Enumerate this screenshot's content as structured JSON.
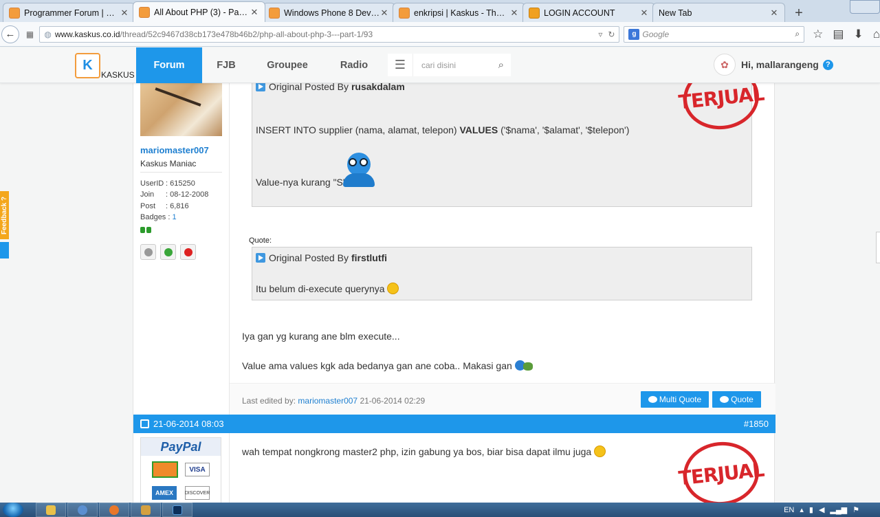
{
  "browser": {
    "tabs": [
      {
        "title": "Programmer Forum | Ka...",
        "icon": "kaskus-favicon",
        "active": false
      },
      {
        "title": "All About PHP (3) - Part...",
        "icon": "kaskus-favicon",
        "active": true
      },
      {
        "title": "Windows Phone 8 Devel...",
        "icon": "kaskus-favicon",
        "active": false
      },
      {
        "title": "enkripsi | Kaskus - The L...",
        "icon": "kaskus-favicon",
        "active": false
      },
      {
        "title": "LOGIN ACCOUNT",
        "icon": "login-favicon",
        "active": false
      },
      {
        "title": "New Tab",
        "icon": "",
        "active": false
      }
    ],
    "url_domain": "www.kaskus.co.id",
    "url_path": "/thread/52c9467d38cb173e478b46b2/php-all-about-php-3---part-1/93",
    "search_placeholder": "Google",
    "search_engine_letter": "g"
  },
  "header": {
    "logo_text": "KASKUS",
    "logo_letter": "K",
    "nav": [
      "Forum",
      "FJB",
      "Groupee",
      "Radio"
    ],
    "search_placeholder": "cari disini",
    "greeting": "Hi, mallarangeng",
    "help": "?"
  },
  "sidebar_feedback": "Feedback ?",
  "post1": {
    "user": {
      "name": "mariomaster007",
      "rank": "Kaskus Maniac",
      "stats": [
        {
          "k": "UserID",
          "v": ": 615250"
        },
        {
          "k": "Join",
          "v": ": 08-12-2008"
        },
        {
          "k": "Post",
          "v": ": 6,816"
        }
      ],
      "badges_label": "Badges :",
      "badges_value": "1"
    },
    "quote1": {
      "posted_by_label": "Original Posted By",
      "author": "rusakdalam",
      "line1_pre": "INSERT INTO supplier (nama, alamat, telepon)",
      "line1_bold": "VALUES",
      "line1_post": "('$nama', '$alamat', '$telepon')",
      "line2": "Value-nya kurang \"S\""
    },
    "quote_label": "Quote:",
    "quote2": {
      "posted_by_label": "Original Posted By",
      "author": "firstlutfi",
      "text": "Itu belum di-execute querynya"
    },
    "body_line1": "Iya gan yg kurang ane blm execute...",
    "body_line2": "Value ama values kgk ada bedanya gan ane coba.. Makasi gan",
    "edited_label": "Last edited by:",
    "edited_user": "mariomaster007",
    "edited_time": "21-06-2014 02:29",
    "multi_quote": "Multi Quote",
    "quote": "Quote",
    "stamp": "TERJUAL"
  },
  "post2": {
    "date": "21-06-2014 08:03",
    "number": "#1850",
    "text": "wah tempat nongkrong master2 php, izin gabung ya bos, biar bisa dapat ilmu juga",
    "stamp": "TERJUAL",
    "paypal": "PayPal",
    "visa": "VISA",
    "amex": "AMEX",
    "discover": "DISCOVER"
  },
  "taskbar": {
    "lang": "EN"
  }
}
